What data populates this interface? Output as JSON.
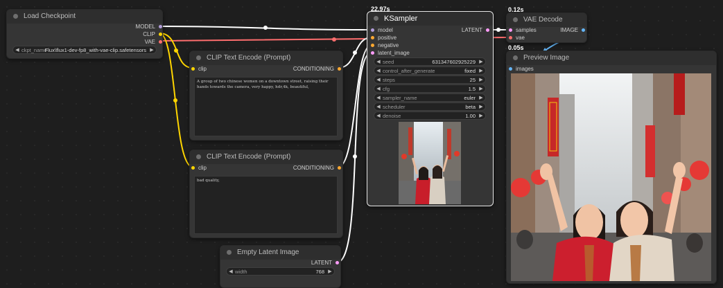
{
  "nodes": {
    "load_checkpoint": {
      "title": "Load Checkpoint",
      "outputs": [
        "MODEL",
        "CLIP",
        "VAE"
      ],
      "ckpt_label": "ckpt_name",
      "ckpt_value": "Flux\\flux1-dev-fp8_with-vae-clip.safetensors"
    },
    "clip_pos": {
      "title": "CLIP Text Encode (Prompt)",
      "input": "clip",
      "output": "CONDITIONING",
      "text": "A group of two chinese women on a downtown street, raising their hands towards the camera, very happy, hdr,4k, beautiful,"
    },
    "clip_neg": {
      "title": "CLIP Text Encode (Prompt)",
      "input": "clip",
      "output": "CONDITIONING",
      "text": "bad quality,"
    },
    "empty_latent": {
      "title": "Empty Latent Image",
      "output": "LATENT",
      "width_label": "width",
      "width_value": "768"
    },
    "ksampler": {
      "title": "KSampler",
      "timing": "22.97s",
      "inputs": [
        "model",
        "positive",
        "negative",
        "latent_image"
      ],
      "output": "LATENT",
      "widgets": [
        {
          "label": "seed",
          "value": "631347602925229"
        },
        {
          "label": "control_after_generate",
          "value": "fixed"
        },
        {
          "label": "steps",
          "value": "25"
        },
        {
          "label": "cfg",
          "value": "1.5"
        },
        {
          "label": "sampler_name",
          "value": "euler"
        },
        {
          "label": "scheduler",
          "value": "beta"
        },
        {
          "label": "denoise",
          "value": "1.00"
        }
      ]
    },
    "vae_decode": {
      "title": "VAE Decode",
      "timing": "0.12s",
      "inputs": [
        "samples",
        "vae"
      ],
      "output": "IMAGE"
    },
    "preview": {
      "title": "Preview Image",
      "timing": "0.05s",
      "input": "images"
    }
  },
  "colors": {
    "model": "#b39ddb",
    "clip": "#ffd500",
    "vae": "#ff6e6e",
    "conditioning": "#ffa931",
    "latent": "#ff9cf9",
    "image": "#64b5f6",
    "wire_white": "#ffffff"
  },
  "icons": {
    "arrow_left": "◀",
    "arrow_right": "▶"
  }
}
